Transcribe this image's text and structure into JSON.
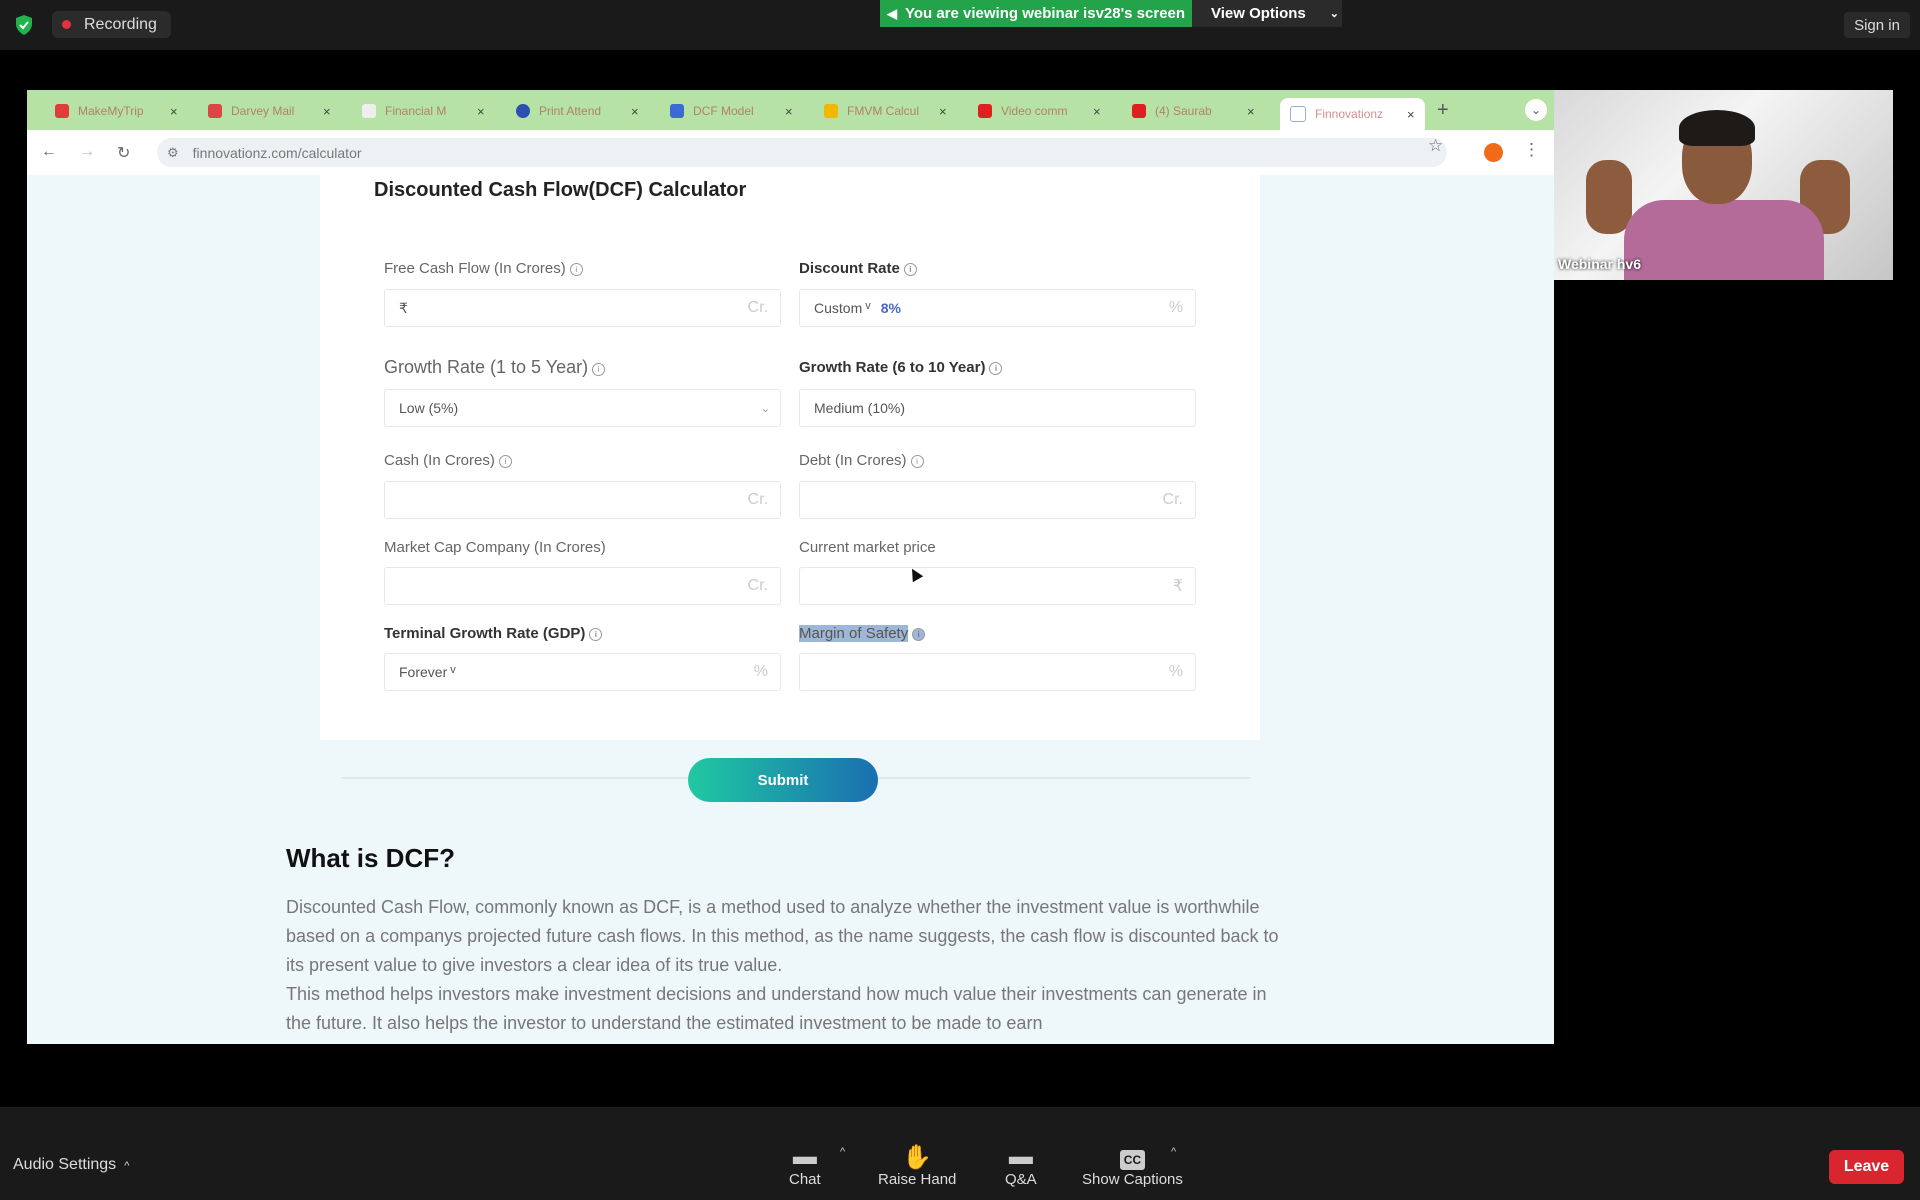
{
  "zoom_top": {
    "recording": "Recording",
    "viewing_banner": "You are viewing webinar isv28's screen",
    "view_options": "View Options",
    "sign_in": "Sign in"
  },
  "browser": {
    "tabs": [
      {
        "label": "MakeMyTrip"
      },
      {
        "label": "Darvey Mail"
      },
      {
        "label": "Financial M"
      },
      {
        "label": "Print Attend"
      },
      {
        "label": "DCF Model"
      },
      {
        "label": "FMVM Calcul"
      },
      {
        "label": "Video comm"
      },
      {
        "label": "(4) Saurab"
      },
      {
        "label": "Finnovationz"
      }
    ],
    "url": "finnovationz.com/calculator"
  },
  "calculator": {
    "title": "Discounted Cash Flow(DCF) Calculator",
    "free_cash_flow": {
      "label": "Free Cash Flow (In Crores)",
      "prefix": "₹",
      "suffix": "Cr."
    },
    "discount_rate": {
      "label": "Discount Rate",
      "mode": "Custom",
      "value": "8%",
      "suffix": "%"
    },
    "growth_1_5": {
      "label": "Growth Rate (1 to 5 Year)",
      "value": "Low (5%)"
    },
    "growth_6_10": {
      "label": "Growth Rate (6 to 10 Year)",
      "value": "Medium (10%)"
    },
    "cash": {
      "label": "Cash (In Crores)",
      "suffix": "Cr."
    },
    "debt": {
      "label": "Debt (In Crores)",
      "suffix": "Cr."
    },
    "market_cap": {
      "label": "Market Cap Company (In Crores)",
      "suffix": "Cr."
    },
    "current_price": {
      "label": "Current market price",
      "suffix": "₹"
    },
    "terminal_growth": {
      "label": "Terminal Growth Rate (GDP)",
      "value": "Forever",
      "suffix": "%"
    },
    "margin_safety": {
      "label": "Margin of Safety",
      "suffix": "%"
    },
    "submit": "Submit"
  },
  "article": {
    "heading": "What is DCF?",
    "p1": "Discounted Cash Flow, commonly known as DCF, is a method used to analyze whether the investment value is worthwhile based on a companys projected future cash flows. In this method, as the name suggests, the cash flow is discounted back to its present value to give investors a clear idea of its true value.",
    "p2": "This method helps investors make investment decisions and understand how much value their investments can generate in the future. It also helps the investor to understand the estimated investment to be made to earn"
  },
  "video": {
    "name": "Webinar hv6"
  },
  "zoom_bottom": {
    "audio": "Audio Settings",
    "chat": "Chat",
    "raise_hand": "Raise Hand",
    "qa": "Q&A",
    "captions": "Show Captions",
    "leave": "Leave"
  }
}
